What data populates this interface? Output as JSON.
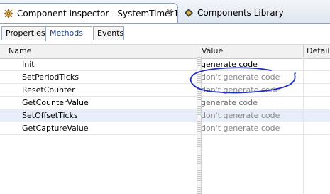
{
  "editor_tabs": [
    {
      "label": "Component Inspector - SystemTimer1",
      "icon": "gear-icon",
      "active": true
    },
    {
      "label": "Components Library",
      "icon": "components-icon",
      "active": false
    }
  ],
  "view_tabs": [
    "Properties",
    "Methods",
    "Events"
  ],
  "selected_view_tab": "Methods",
  "table": {
    "columns": [
      "Name",
      "Value",
      "Details"
    ],
    "rows": [
      {
        "name": "Init",
        "value": "generate code"
      },
      {
        "name": "SetPeriodTicks",
        "value": "don't generate code"
      },
      {
        "name": "ResetCounter",
        "value": "don't generate code"
      },
      {
        "name": "GetCounterValue",
        "value": "generate code"
      },
      {
        "name": "SetOffsetTicks",
        "value": "don't generate code"
      },
      {
        "name": "GetCaptureValue",
        "value": "don't generate code"
      }
    ]
  },
  "annotation": {
    "shape": "hand-drawn ellipse",
    "color": "#1e2fbf",
    "target_row": "SetPeriodTicks"
  }
}
